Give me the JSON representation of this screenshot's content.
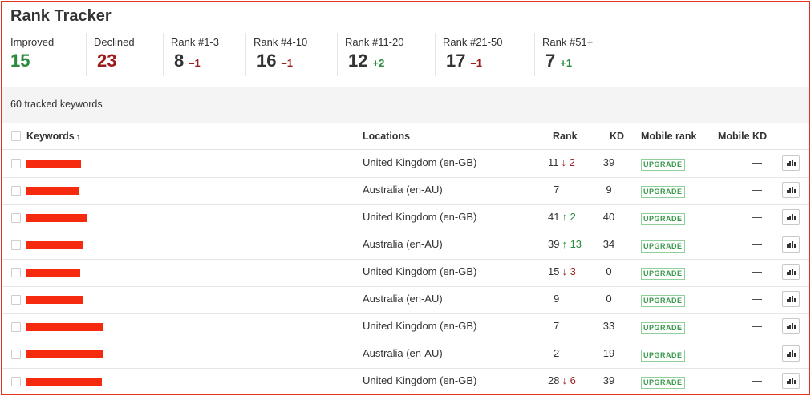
{
  "title": "Rank Tracker",
  "stats": [
    {
      "label": "Improved",
      "value": "15",
      "delta": "",
      "color": "#2b8a3e"
    },
    {
      "label": "Declined",
      "value": "23",
      "delta": "",
      "color": "#9b1c1c"
    },
    {
      "label": "Rank #1-3",
      "value": "8",
      "delta": "–1",
      "delta_dir": "down"
    },
    {
      "label": "Rank #4-10",
      "value": "16",
      "delta": "–1",
      "delta_dir": "down"
    },
    {
      "label": "Rank #11-20",
      "value": "12",
      "delta": "+2",
      "delta_dir": "up"
    },
    {
      "label": "Rank #21-50",
      "value": "17",
      "delta": "–1",
      "delta_dir": "down"
    },
    {
      "label": "Rank #51+",
      "value": "7",
      "delta": "+1",
      "delta_dir": "up"
    }
  ],
  "tracked": "60 tracked keywords",
  "columns": {
    "keywords": "Keywords",
    "sort_arrow": "↑",
    "locations": "Locations",
    "rank": "Rank",
    "kd": "KD",
    "mobile_rank": "Mobile rank",
    "mobile_kd": "Mobile KD"
  },
  "upgrade_label": "UPGRADE",
  "dash": "—",
  "rows": [
    {
      "location": "United Kingdom (en-GB)",
      "rank": "11",
      "arrow": "↓",
      "change": "2",
      "dir": "down",
      "kd": "39"
    },
    {
      "location": "Australia (en-AU)",
      "rank": "7",
      "arrow": "",
      "change": "",
      "dir": "none",
      "kd": "9"
    },
    {
      "location": "United Kingdom (en-GB)",
      "rank": "41",
      "arrow": "↑",
      "change": "2",
      "dir": "up",
      "kd": "40"
    },
    {
      "location": "Australia (en-AU)",
      "rank": "39",
      "arrow": "↑",
      "change": "13",
      "dir": "up",
      "kd": "34"
    },
    {
      "location": "United Kingdom (en-GB)",
      "rank": "15",
      "arrow": "↓",
      "change": "3",
      "dir": "down",
      "kd": "0"
    },
    {
      "location": "Australia (en-AU)",
      "rank": "9",
      "arrow": "",
      "change": "",
      "dir": "none",
      "kd": "0"
    },
    {
      "location": "United Kingdom (en-GB)",
      "rank": "7",
      "arrow": "",
      "change": "",
      "dir": "none",
      "kd": "33"
    },
    {
      "location": "Australia (en-AU)",
      "rank": "2",
      "arrow": "",
      "change": "",
      "dir": "none",
      "kd": "19"
    },
    {
      "location": "United Kingdom (en-GB)",
      "rank": "28",
      "arrow": "↓",
      "change": "6",
      "dir": "down",
      "kd": "39"
    }
  ],
  "colors": {
    "accent_border": "#e8331c",
    "redaction": "#f52a0f",
    "up": "#2b8a3e",
    "down": "#9b1c1c"
  }
}
